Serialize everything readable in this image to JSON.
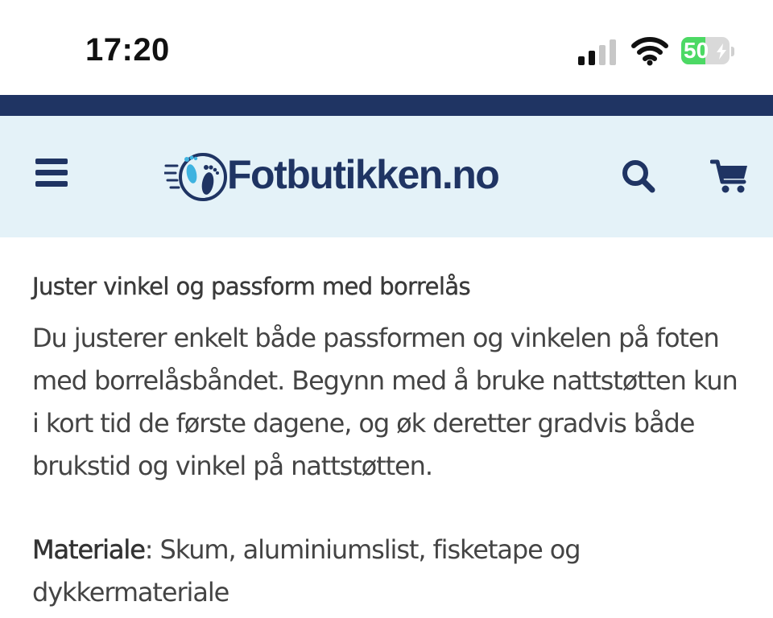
{
  "status_bar": {
    "time": "17:20",
    "battery_percent": "50",
    "battery_level": 0.5,
    "battery_color": "#4cd964",
    "icons": [
      "signal-icon",
      "wifi-icon",
      "battery-icon",
      "charging-bolt-icon"
    ]
  },
  "header": {
    "stripe_color": "#1f3463",
    "background_color": "#e4f2f8",
    "brand_color": "#1f3463",
    "logo_text": "Fotbutikken.no",
    "icons": [
      "hamburger-menu-icon",
      "feet-logo-icon",
      "search-icon",
      "shopping-cart-icon"
    ]
  },
  "content": {
    "heading": "Juster vinkel og passform med borrelås",
    "paragraph": "Du justerer enkelt både passformen og vinkelen på foten med borrelåsbåndet. Begynn med å bruke nattstøtten kun i kort tid de første dagene, og øk deretter gradvis både brukstid og vinkel på nattstøtten.",
    "material_label": "Materiale",
    "material_value": ": Skum, aluminiumslist, fisketape og dykkermateriale"
  }
}
